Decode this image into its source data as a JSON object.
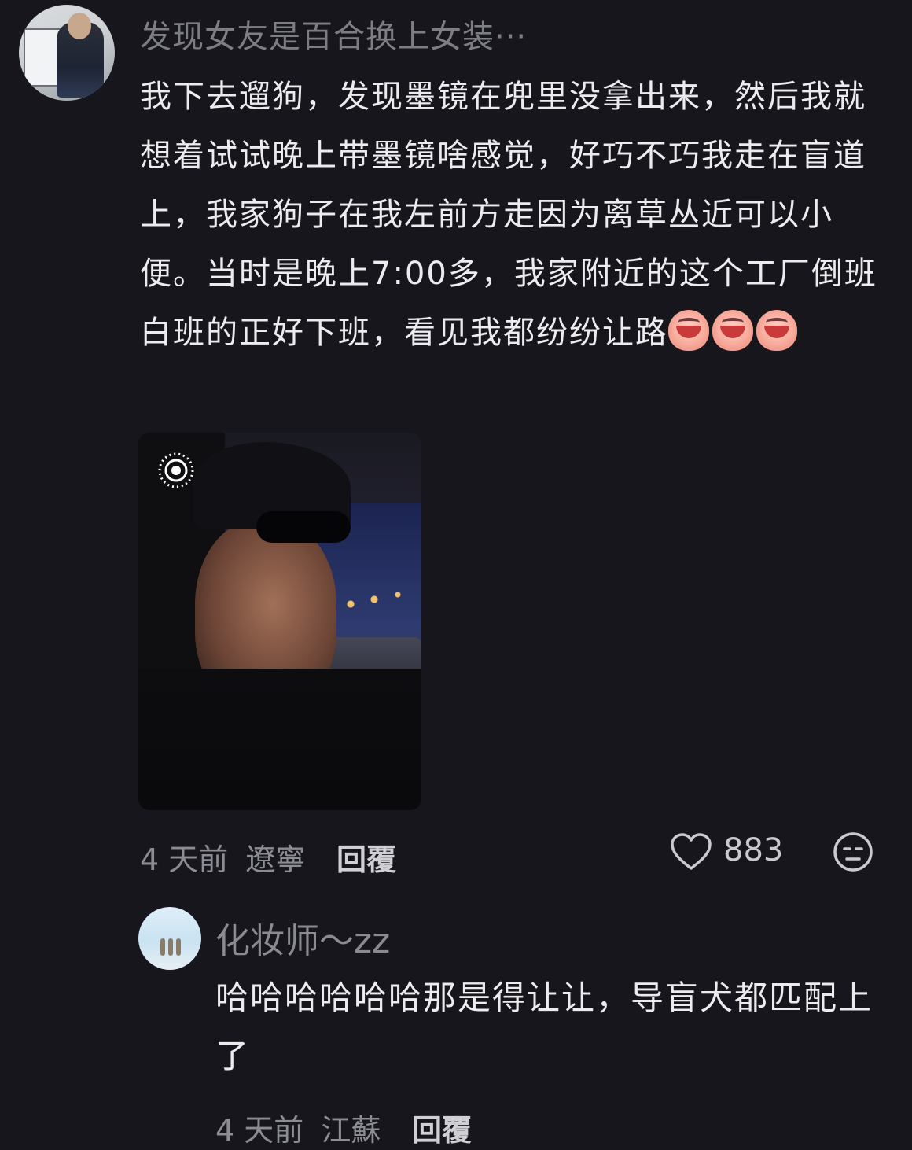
{
  "comment1": {
    "username": "发现女友是百合换上女装···",
    "text_before_emoji": "我下去遛狗，发现墨镜在兜里没拿出来，然后我就想着试试晚上带墨镜啥感觉，好巧不巧我走在盲道上，我家狗子在我左前方走因为离草丛近可以小便。当时是晚上7:00多，我家附近的这个工厂倒班白班的正好下班，看见我都纷纷让路",
    "emoji_icon": "crying-face-emoji",
    "emoji_count": 3,
    "time": "4 天前",
    "location": "遼寧",
    "reply_label": "回覆",
    "like_count": "883"
  },
  "comment2": {
    "username": "化妆师～zz",
    "text": "哈哈哈哈哈哈那是得让让，导盲犬都匹配上了",
    "time": "4 天前",
    "location": "江蘇",
    "reply_label": "回覆"
  }
}
